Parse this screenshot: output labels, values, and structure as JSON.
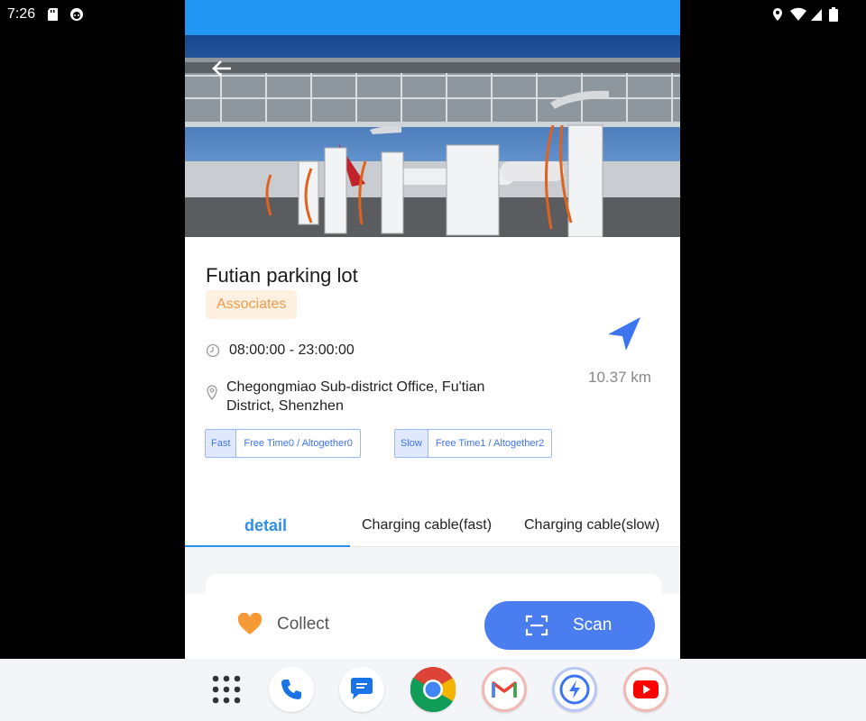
{
  "status_bar": {
    "time": "7:26"
  },
  "station": {
    "name": "Futian parking lot",
    "tag": "Associates",
    "hours": "08:00:00 - 23:00:00",
    "address": "Chegongmiao Sub-district Office, Fu'tian District, Shenzhen",
    "distance": "10.37 km",
    "chargers": [
      {
        "key": "Fast",
        "value": "Free Time0 / Altogether0"
      },
      {
        "key": "Slow",
        "value": "Free Time1 / Altogether2"
      }
    ]
  },
  "tabs": [
    {
      "label": "detail",
      "active": true
    },
    {
      "label": "Charging cable(fast)",
      "active": false
    },
    {
      "label": "Charging cable(slow)",
      "active": false
    }
  ],
  "actions": {
    "collect": "Collect",
    "scan": "Scan"
  },
  "dock": [
    "app-drawer-icon",
    "phone-icon",
    "messages-icon",
    "chrome-icon",
    "gmail-icon",
    "charging-app-icon",
    "youtube-icon"
  ],
  "colors": {
    "accent": "#2196f3",
    "primary": "#4a7ef0",
    "tag_text": "#f29a4a",
    "tag_bg": "#fff1e2",
    "tab_active": "#2f8fe8"
  }
}
